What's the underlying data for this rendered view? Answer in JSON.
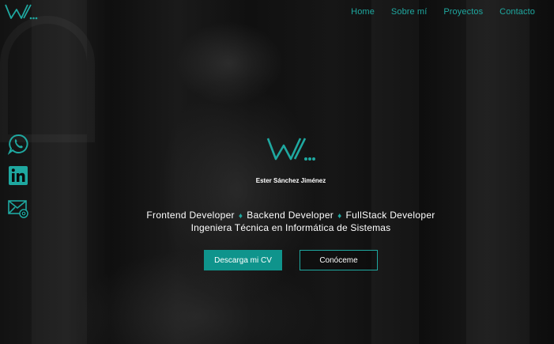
{
  "nav": {
    "items": [
      "Home",
      "Sobre mí",
      "Proyectos",
      "Contacto"
    ]
  },
  "hero": {
    "name": "Ester Sánchez Jiménez",
    "roles": [
      "Frontend Developer",
      "Backend Developer",
      "FullStack Developer"
    ],
    "separator": "♦",
    "degree": "Ingeniera Técnica en Informática de Sistemas",
    "cv_button": "Descarga mi CV",
    "about_button": "Conóceme"
  },
  "social": [
    "whatsapp-icon",
    "linkedin-icon",
    "email-icon"
  ],
  "colors": {
    "accent": "#1fa8a0",
    "button": "#0f948c",
    "background": "#0b0b0b"
  }
}
